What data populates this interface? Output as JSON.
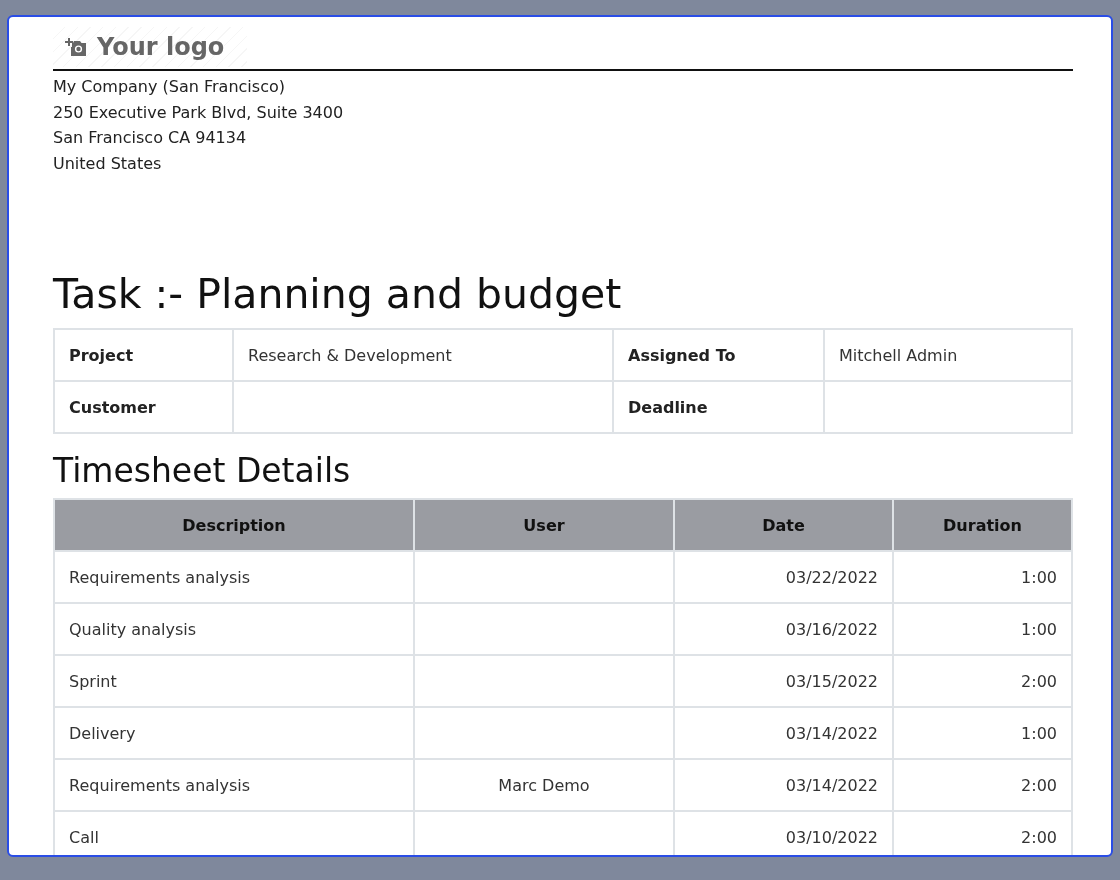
{
  "logo": {
    "text": "Your logo"
  },
  "company": {
    "lines": [
      "My Company (San Francisco)",
      "250 Executive Park Blvd, Suite 3400",
      "San Francisco CA 94134",
      "United States"
    ]
  },
  "title": "Task :- Planning and budget",
  "info": [
    {
      "label": "Project",
      "value": "Research & Development",
      "label_2": "Assigned To",
      "value_2": "Mitchell Admin"
    },
    {
      "label": "Customer",
      "label_2": "Deadline"
    }
  ],
  "timesheet": {
    "heading": "Timesheet Details",
    "columns": [
      "Description",
      "User",
      "Date",
      "Duration"
    ],
    "rows": [
      {
        "description": "Requirements analysis",
        "date": "03/22/2022",
        "duration": "1:00"
      },
      {
        "description": "Quality analysis",
        "date": "03/16/2022",
        "duration": "1:00"
      },
      {
        "description": "Sprint",
        "date": "03/15/2022",
        "duration": "2:00"
      },
      {
        "description": "Delivery",
        "date": "03/14/2022",
        "duration": "1:00"
      },
      {
        "description": "Requirements analysis",
        "user": "Marc Demo",
        "date": "03/14/2022",
        "duration": "2:00"
      },
      {
        "description": "Call",
        "date": "03/10/2022",
        "duration": "2:00"
      }
    ]
  }
}
